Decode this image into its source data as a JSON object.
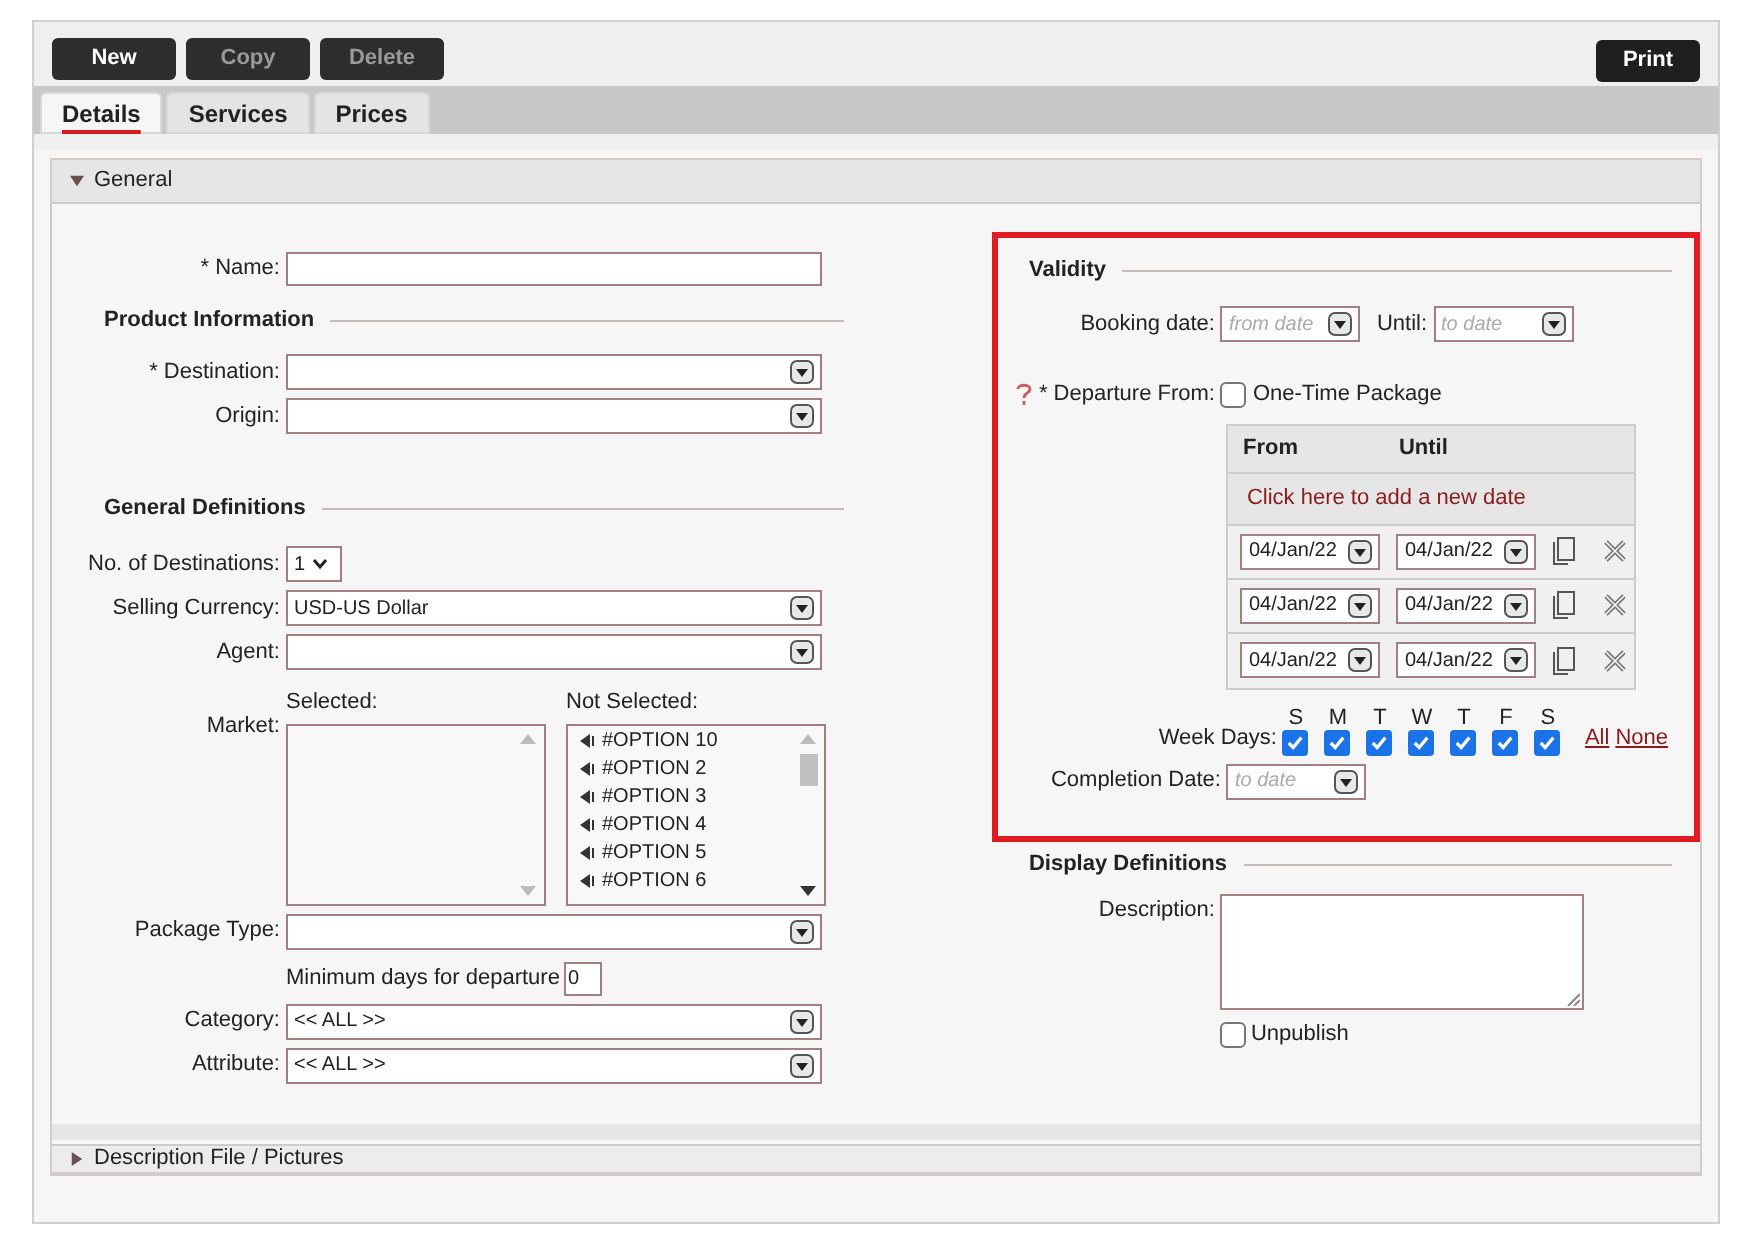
{
  "toolbar": {
    "buttons": [
      {
        "label": "New",
        "disabled": false
      },
      {
        "label": "Copy",
        "disabled": true
      },
      {
        "label": "Delete",
        "disabled": true
      }
    ],
    "print": "Print"
  },
  "tabs": [
    {
      "label": "Details",
      "selected": true
    },
    {
      "label": "Services",
      "selected": false
    },
    {
      "label": "Prices",
      "selected": false
    }
  ],
  "general_section": {
    "title": "General",
    "expanded": true
  },
  "name_field": {
    "label": "* Name:"
  },
  "product_information": {
    "title": "Product Information",
    "fields": [
      {
        "label": "* Destination:"
      },
      {
        "label": "Origin:"
      }
    ]
  },
  "general_definitions": {
    "title": "General Definitions",
    "fields": [
      {
        "kind": "small-select",
        "label": "No. of Destinations:",
        "value": "1"
      },
      {
        "kind": "select",
        "label": "Selling Currency:",
        "value": "USD-US Dollar"
      },
      {
        "kind": "select",
        "label": "Agent:"
      },
      {
        "kind": "market",
        "label": "Market:",
        "selected_label": "Selected:",
        "not_selected_label": "Not Selected:",
        "not_selected_options": [
          "#OPTION 10",
          "#OPTION 2",
          "#OPTION 3",
          "#OPTION 4",
          "#OPTION 5",
          "#OPTION 6"
        ]
      },
      {
        "kind": "select",
        "label": "Package Type:"
      },
      {
        "kind": "number",
        "label": "Minimum days for departure",
        "value": "0"
      },
      {
        "kind": "select",
        "label": "Category:",
        "value": "<< ALL >>"
      },
      {
        "kind": "select",
        "label": "Attribute:",
        "value": "<< ALL >>"
      }
    ]
  },
  "validity": {
    "title": "Validity",
    "booking_date": {
      "label": "Booking date:",
      "placeholder": "from date"
    },
    "until": {
      "label": "Until:",
      "placeholder": "to date"
    },
    "departure": {
      "label": "* Departure From:",
      "checkbox_label": "One-Time Package",
      "checked": false
    },
    "dates_table": {
      "columns": [
        "From",
        "Until"
      ],
      "add_link": "Click here to add a new date",
      "rows": [
        {
          "from": "04/Jan/22",
          "until": "04/Jan/22"
        },
        {
          "from": "04/Jan/22",
          "until": "04/Jan/22"
        },
        {
          "from": "04/Jan/22",
          "until": "04/Jan/22"
        }
      ]
    },
    "week_days": {
      "label": "Week Days:",
      "days": [
        {
          "letter": "S",
          "checked": true
        },
        {
          "letter": "M",
          "checked": true
        },
        {
          "letter": "T",
          "checked": true
        },
        {
          "letter": "W",
          "checked": true
        },
        {
          "letter": "T",
          "checked": true
        },
        {
          "letter": "F",
          "checked": true
        },
        {
          "letter": "S",
          "checked": true
        }
      ],
      "all_link": "All",
      "none_link": "None"
    },
    "completion_date": {
      "label": "Completion Date:",
      "placeholder": "to date"
    }
  },
  "display_definitions": {
    "title": "Display Definitions",
    "description_label": "Description:",
    "unpublish": {
      "label": "Unpublish",
      "checked": false
    }
  },
  "description_section": {
    "title": "Description File / Pictures",
    "expanded": false
  }
}
